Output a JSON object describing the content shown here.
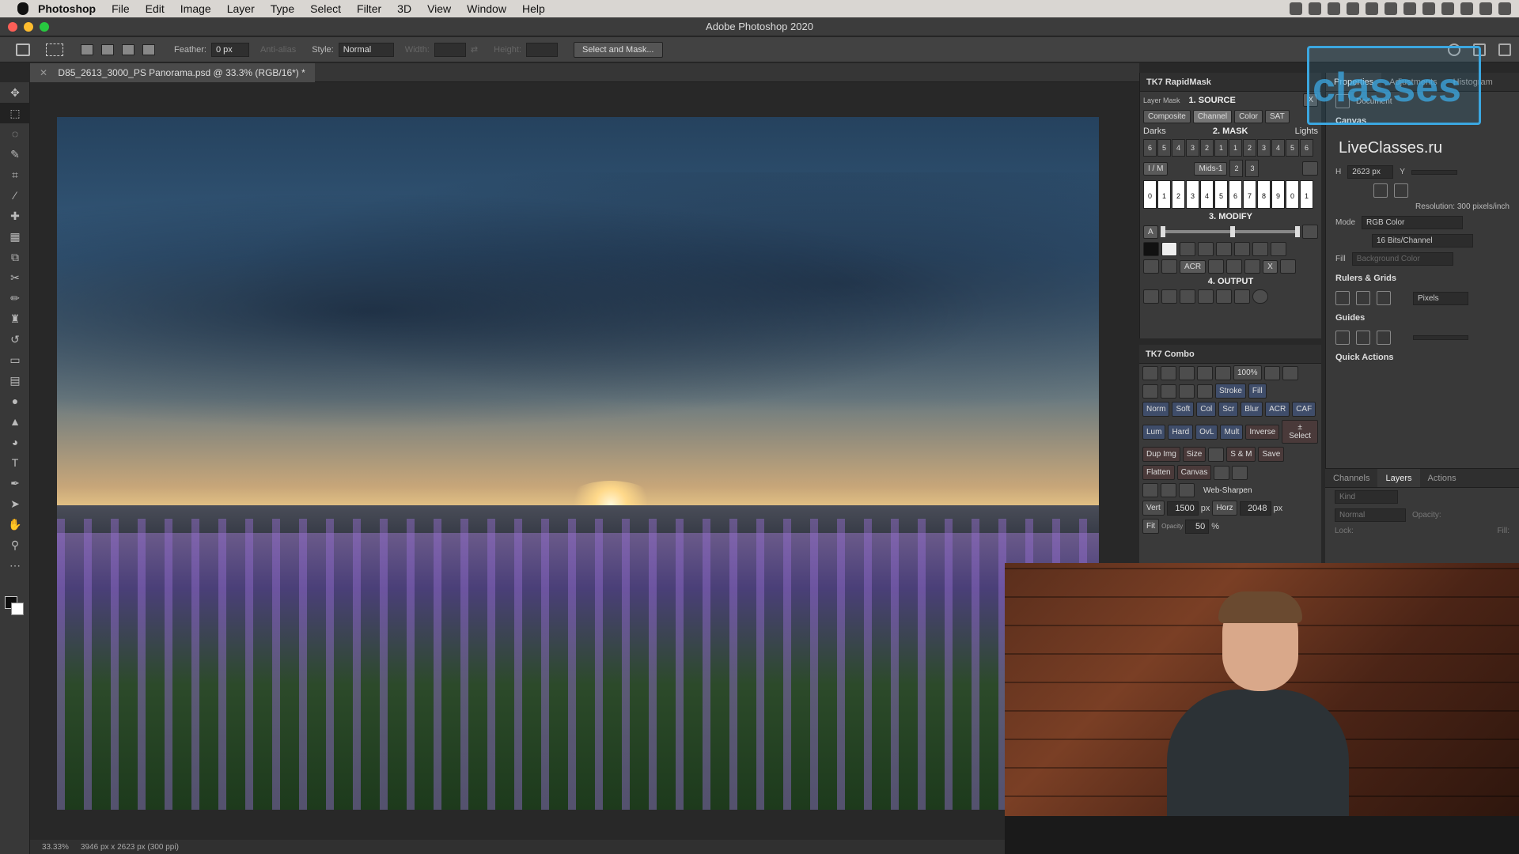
{
  "menubar": {
    "app_name": "Photoshop",
    "items": [
      "File",
      "Edit",
      "Image",
      "Layer",
      "Type",
      "Select",
      "Filter",
      "3D",
      "View",
      "Window",
      "Help"
    ]
  },
  "window": {
    "title": "Adobe Photoshop 2020"
  },
  "options": {
    "feather_label": "Feather:",
    "feather_value": "0 px",
    "antialias_label": "Anti-alias",
    "style_label": "Style:",
    "style_value": "Normal",
    "width_label": "Width:",
    "height_label": "Height:",
    "select_mask_label": "Select and Mask..."
  },
  "document": {
    "tab_title": "D85_2613_3000_PS Panorama.psd @ 33.3% (RGB/16*) *",
    "zoom": "33.33%",
    "info": "3946 px x 2623 px (300 ppi)"
  },
  "rapidmask": {
    "title": "TK7 RapidMask",
    "layer_mask_label": "Layer Mask",
    "source_label": "1. SOURCE",
    "source_buttons": [
      "Composite",
      "Channel",
      "Color",
      "SAT"
    ],
    "mask_label": "2. MASK",
    "darks_label": "Darks",
    "lights_label": "Lights",
    "dark_numbers": [
      "6",
      "5",
      "4",
      "3",
      "2",
      "1"
    ],
    "light_numbers": [
      "1",
      "2",
      "3",
      "4",
      "5",
      "6"
    ],
    "im_label": "I / M",
    "mids_label": "Mids-1",
    "mids_numbers": [
      "2",
      "3"
    ],
    "slider_numbers": [
      "0",
      "1",
      "2",
      "3",
      "4",
      "5",
      "6",
      "7",
      "8",
      "9",
      "0",
      "1"
    ],
    "modify_label": "3. MODIFY",
    "modify_a": "A",
    "acr_label": "ACR",
    "x_label": "X",
    "output_label": "4. OUTPUT"
  },
  "combo": {
    "title": "TK7 Combo",
    "percent": "100%",
    "stroke": "Stroke",
    "fill": "Fill",
    "blur": "Blur",
    "acr": "ACR",
    "caf": "CAF",
    "blend_row1": [
      "Norm",
      "Soft",
      "Col",
      "Scr"
    ],
    "blend_row2": [
      "Lum",
      "Hard",
      "OvL",
      "Mult"
    ],
    "inverse": "Inverse",
    "select": "± Select",
    "sm": "S & M",
    "save": "Save",
    "dup_img": "Dup Img",
    "size": "Size",
    "flatten": "Flatten",
    "canvas": "Canvas",
    "web_sharpen": "Web-Sharpen",
    "vert_label": "Vert",
    "vert_value": "1500",
    "horz_label": "Horz",
    "horz_value": "2048",
    "fit_label": "Fit",
    "opacity_label": "Opacity",
    "opacity_value": "50",
    "px": "px",
    "pct": "%"
  },
  "properties": {
    "tabs": [
      "Properties",
      "Adjustments",
      "Histogram"
    ],
    "doc_label": "Document",
    "canvas_label": "Canvas",
    "h_label": "H",
    "h_value": "2623 px",
    "y_label": "Y",
    "resolution": "Resolution: 300 pixels/inch",
    "mode_label": "Mode",
    "mode_value": "RGB Color",
    "bits_value": "16 Bits/Channel",
    "fill_label": "Fill",
    "fill_value": "Background Color",
    "rulers_label": "Rulers & Grids",
    "units_value": "Pixels",
    "guides_label": "Guides",
    "quick_actions_label": "Quick Actions"
  },
  "layers": {
    "tabs": [
      "Channels",
      "Layers",
      "Actions"
    ],
    "kind_placeholder": "Kind",
    "blend_mode": "Normal",
    "opacity_label": "Opacity:",
    "lock_label": "Lock:",
    "fill_label": "Fill:"
  },
  "watermark": {
    "text": "classes",
    "site": "LiveClasses.ru"
  },
  "colors": {
    "accent": "#3ba7e0",
    "panel": "#3a3a3a",
    "bg": "#282828"
  }
}
